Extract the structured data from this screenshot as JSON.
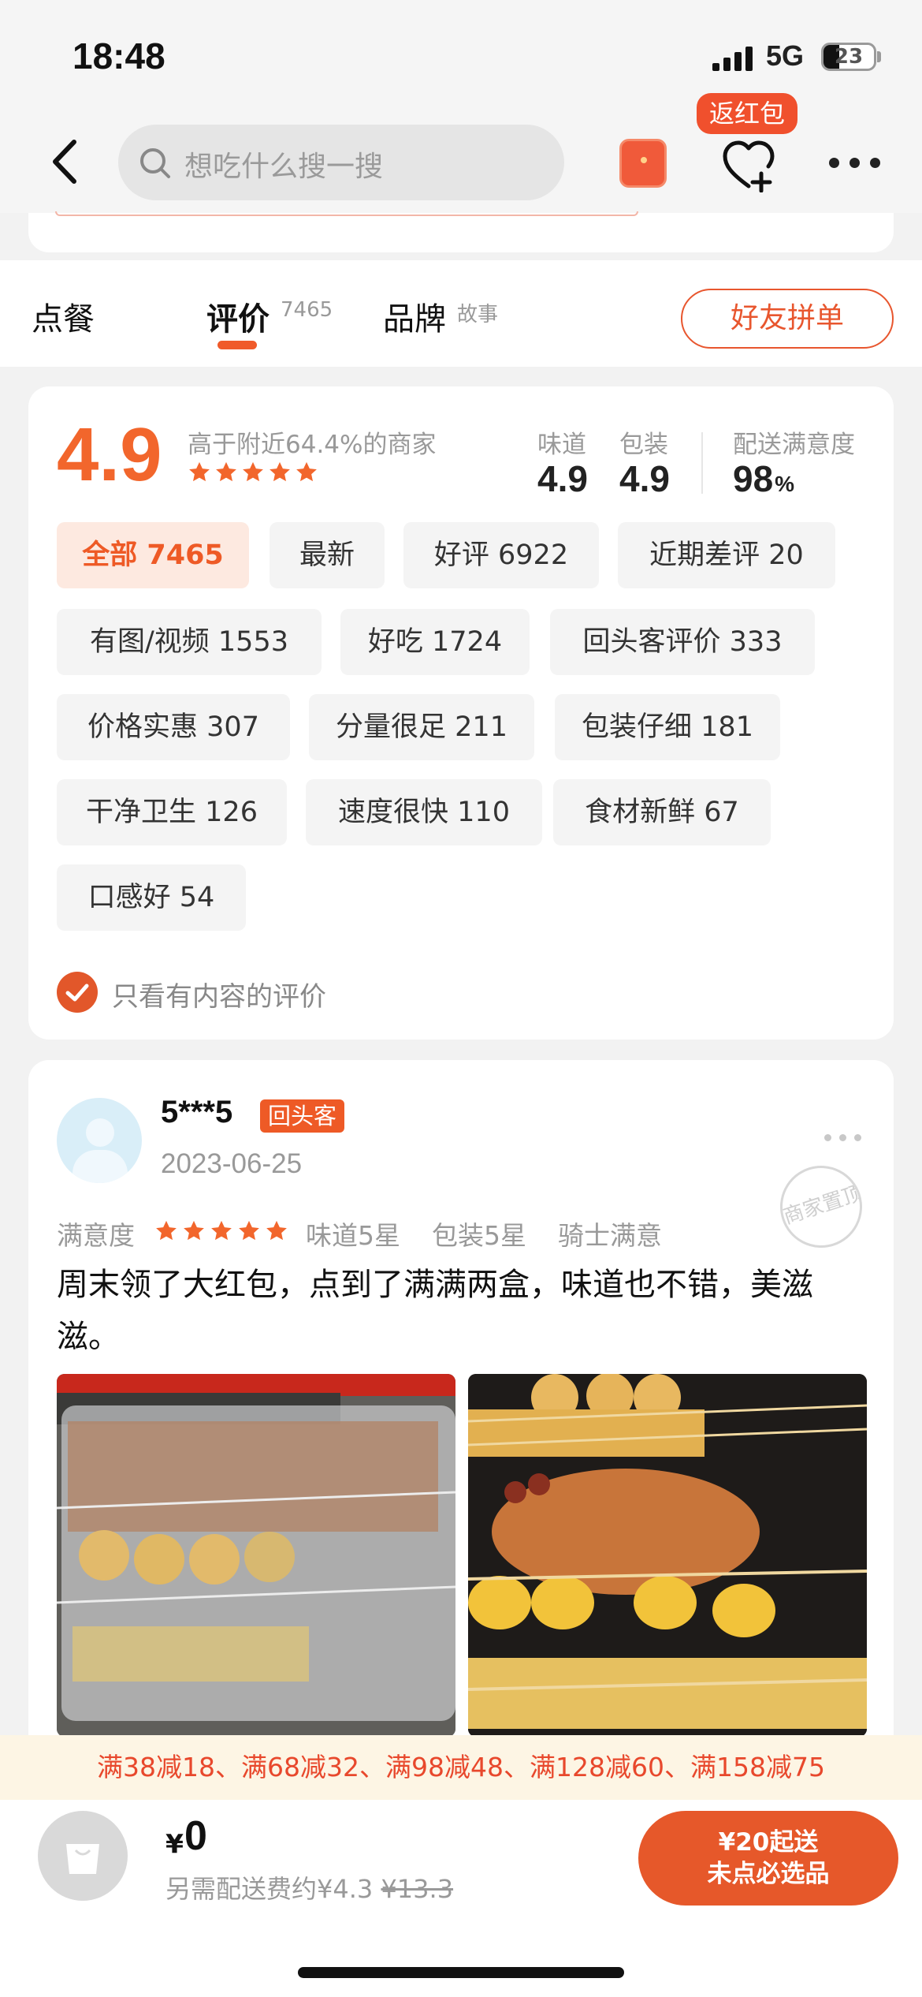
{
  "status_bar": {
    "time": "18:48",
    "network": "5G",
    "battery": "23"
  },
  "nav": {
    "search_placeholder": "想吃什么搜一搜",
    "red_packet_badge": "返红包"
  },
  "tabs": {
    "order": "点餐",
    "review": "评价",
    "review_count": "7465",
    "brand": "品牌",
    "brand_sup": "故事",
    "group_order": "好友拼单"
  },
  "rating": {
    "score": "4.9",
    "beat_text": "高于附近64.4%的商家",
    "stars": 5,
    "taste_label": "味道",
    "taste_value": "4.9",
    "pack_label": "包装",
    "pack_value": "4.9",
    "delivery_label": "配送满意度",
    "delivery_value": "98",
    "delivery_unit": "%"
  },
  "filters": [
    {
      "label": "全部 7465",
      "active": true
    },
    {
      "label": "最新"
    },
    {
      "label": "好评 6922"
    },
    {
      "label": "近期差评 20"
    },
    {
      "label": "有图/视频 1553"
    },
    {
      "label": "好吃 1724"
    },
    {
      "label": "回头客评价 333"
    },
    {
      "label": "价格实惠 307"
    },
    {
      "label": "分量很足 211"
    },
    {
      "label": "包装仔细 181"
    },
    {
      "label": "干净卫生 126"
    },
    {
      "label": "速度很快 110"
    },
    {
      "label": "食材新鲜 67"
    },
    {
      "label": "口感好 54"
    }
  ],
  "content_only_label": "只看有内容的评价",
  "review": {
    "user": "5***5",
    "badge": "回头客",
    "date": "2023-06-25",
    "stamp": "商家置顶",
    "satisfaction_label": "满意度",
    "stars": 5,
    "taste": "味道5星",
    "pack": "包装5星",
    "rider": "骑士满意",
    "text": "周末领了大红包，点到了满满两盒，味道也不错，美滋滋。"
  },
  "promo": "满38减18、满68减32、满98减48、满128减60、满158减75",
  "cart": {
    "currency": "¥",
    "price": "0",
    "fee_text": "另需配送费约¥4.3",
    "fee_original": "¥13.3",
    "min_line1": "¥20起送",
    "min_line2": "未点必选品"
  },
  "colors": {
    "accent": "#ee5a26",
    "promo_bg": "#fdf5e4"
  }
}
